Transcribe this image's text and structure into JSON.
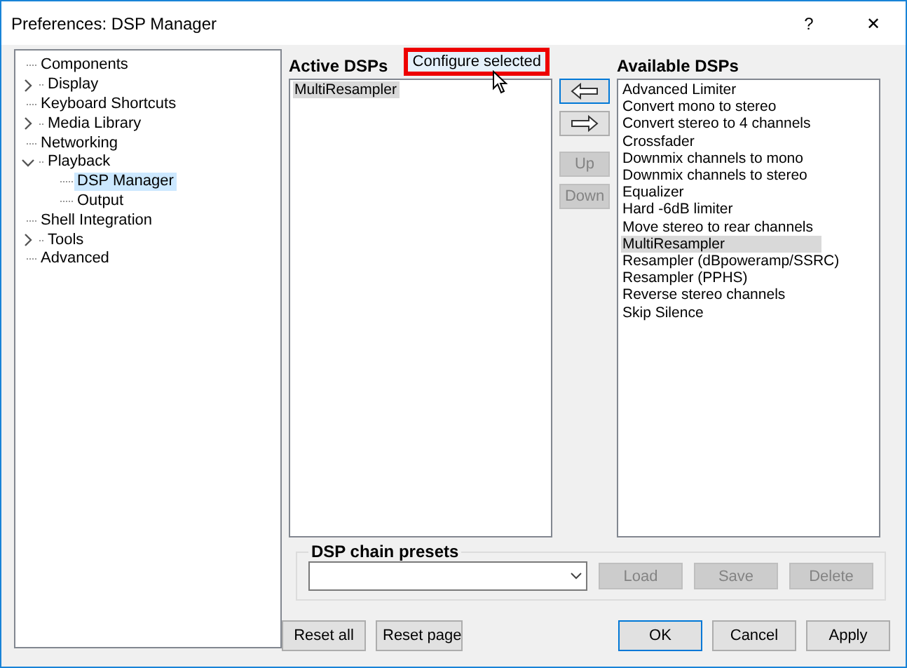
{
  "window": {
    "title": "Preferences: DSP Manager",
    "buttons": [
      "?",
      "✕"
    ]
  },
  "tree": [
    {
      "label": "Components",
      "selected": false
    },
    {
      "label": "Display",
      "selected": false,
      "expanded": false
    },
    {
      "label": "Keyboard Shortcuts",
      "selected": false
    },
    {
      "label": "Media Library",
      "selected": false,
      "expanded": false
    },
    {
      "label": "Networking",
      "selected": false
    },
    {
      "label": "Playback",
      "selected": false,
      "expanded": true,
      "children": [
        {
          "label": "DSP Manager",
          "selected": true
        },
        {
          "label": "Output",
          "selected": false
        }
      ]
    },
    {
      "label": "Shell Integration",
      "selected": false
    },
    {
      "label": "Tools",
      "selected": false,
      "expanded": false
    },
    {
      "label": "Advanced",
      "selected": false
    }
  ],
  "active_dsps": {
    "title": "Active DSPs",
    "configure_button": {
      "label": "Configure selected",
      "highlighted": true
    },
    "items": [
      {
        "label": "MultiResampler",
        "selected": true
      }
    ]
  },
  "move_buttons": [
    {
      "kind": "arrow-left",
      "disabled": false,
      "focused": true
    },
    {
      "kind": "arrow-right",
      "disabled": false,
      "focused": false
    },
    {
      "kind": "text",
      "label": "Up",
      "disabled": true,
      "focused": false
    },
    {
      "kind": "text",
      "label": "Down",
      "disabled": true,
      "focused": false
    }
  ],
  "available_dsps": {
    "title": "Available DSPs",
    "items": [
      {
        "label": "Advanced Limiter",
        "selected": false
      },
      {
        "label": "Convert mono to stereo",
        "selected": false
      },
      {
        "label": "Convert stereo to 4 channels",
        "selected": false
      },
      {
        "label": "Crossfader",
        "selected": false
      },
      {
        "label": "Downmix channels to mono",
        "selected": false
      },
      {
        "label": "Downmix channels to stereo",
        "selected": false
      },
      {
        "label": "Equalizer",
        "selected": false
      },
      {
        "label": "Hard -6dB limiter",
        "selected": false
      },
      {
        "label": "Move stereo to rear channels",
        "selected": false
      },
      {
        "label": "MultiResampler",
        "selected": true
      },
      {
        "label": "Resampler (dBpoweramp/SSRC)",
        "selected": false
      },
      {
        "label": "Resampler (PPHS)",
        "selected": false
      },
      {
        "label": "Reverse stereo channels",
        "selected": false
      },
      {
        "label": "Skip Silence",
        "selected": false
      }
    ]
  },
  "presets": {
    "title": "DSP chain presets",
    "buttons": [
      {
        "label": "Load",
        "disabled": true
      },
      {
        "label": "Save",
        "disabled": true
      },
      {
        "label": "Delete",
        "disabled": true
      }
    ]
  },
  "footer_left": [
    {
      "label": "Reset all"
    },
    {
      "label": "Reset page"
    }
  ],
  "footer_right": [
    {
      "label": "OK",
      "default": true
    },
    {
      "label": "Cancel",
      "default": false
    },
    {
      "label": "Apply",
      "default": false
    }
  ]
}
